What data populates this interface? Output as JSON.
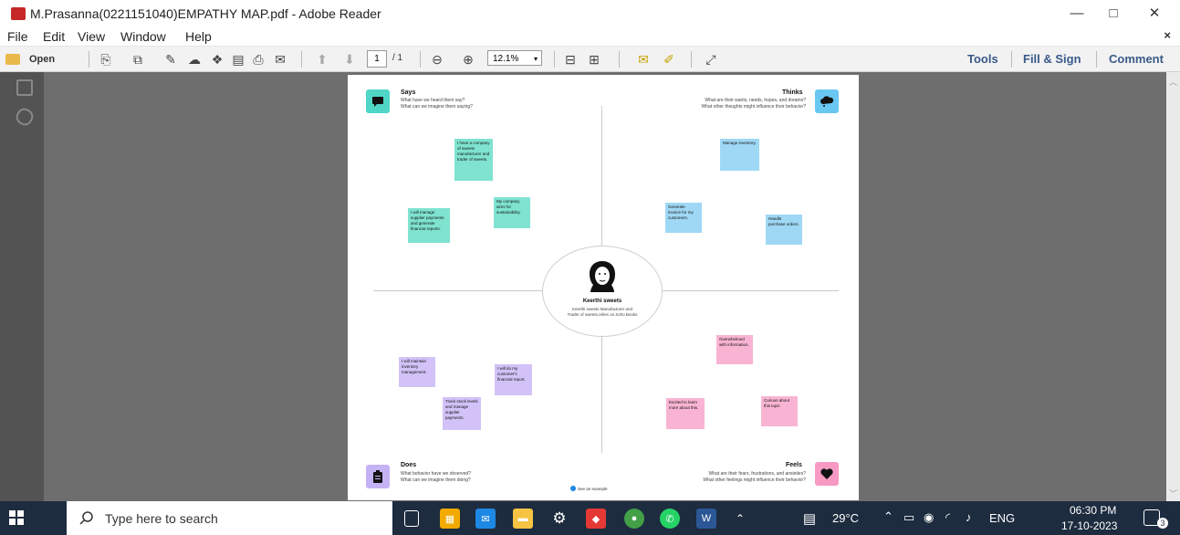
{
  "window": {
    "title": "M.Prasanna(0221151040)EMPATHY MAP.pdf - Adobe Reader",
    "minimize": "—",
    "maximize": "□",
    "close": "✕"
  },
  "menu": {
    "items": [
      "File",
      "Edit",
      "View",
      "Window",
      "Help"
    ],
    "close_doc": "×"
  },
  "toolbar": {
    "open_label": "Open",
    "page_current": "1",
    "page_total": "/ 1",
    "zoom": "12.1%",
    "tools": "Tools",
    "fill_sign": "Fill & Sign",
    "comment": "Comment"
  },
  "map": {
    "says": {
      "title": "Says",
      "desc": [
        "What have we heard them say?",
        "What can we imagine them saying?"
      ]
    },
    "thinks": {
      "title": "Thinks",
      "desc": [
        "What are their wants, needs, hopes, and dreams?",
        "What other thoughts might influence their behavior?"
      ]
    },
    "does": {
      "title": "Does",
      "desc": [
        "What behavior have we observed?",
        "What can we imagine them doing?"
      ]
    },
    "feels": {
      "title": "Feels",
      "desc": [
        "What are their fears, frustrations, and anxieties?",
        "What other feelings might influence their behavior?"
      ]
    },
    "center": {
      "name": "Keerthi sweets",
      "desc": "Keerthi sweets Manufacturer and Trader of sweets,relies on Zoho Books"
    },
    "example": "See an example",
    "notes": {
      "says1": "I have a company of sweets manufacturer and trader of sweets.",
      "says2": "My company aims for sustainability.",
      "says3": "I will manage supplier payments and generate financial reports.",
      "thinks1": "Manage inventory.",
      "thinks2": "Generate invoice for my customers.",
      "thinks3": "Handle purchase orders.",
      "does1": "I will maintain inventory management.",
      "does2": "I will do my customer's financial report.",
      "does3": "Track stock levels and manage supplier payments.",
      "feels1": "Overwhelmed with information.",
      "feels2": "Excited to learn more about this.",
      "feels3": "Curious about this topic"
    }
  },
  "taskbar": {
    "search_placeholder": "Type here to search",
    "weather": "29°C",
    "lang": "ENG",
    "time": "06:30 PM",
    "date": "17-10-2023",
    "notif_count": "3"
  }
}
